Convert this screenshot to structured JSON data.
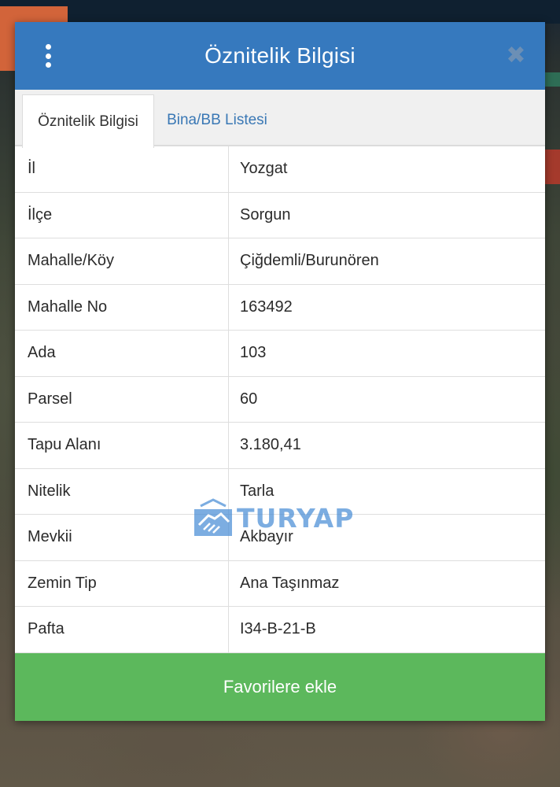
{
  "dialog": {
    "title": "Öznitelik Bilgisi",
    "tabs": [
      {
        "label": "Öznitelik Bilgisi",
        "active": true
      },
      {
        "label": "Bina/BB Listesi",
        "active": false
      }
    ],
    "rows": [
      {
        "label": "İl",
        "value": "Yozgat"
      },
      {
        "label": "İlçe",
        "value": "Sorgun"
      },
      {
        "label": "Mahalle/Köy",
        "value": "Çiğdemli/Burunören"
      },
      {
        "label": "Mahalle No",
        "value": "163492"
      },
      {
        "label": "Ada",
        "value": "103"
      },
      {
        "label": "Parsel",
        "value": "60"
      },
      {
        "label": "Tapu Alanı",
        "value": "3.180,41"
      },
      {
        "label": "Nitelik",
        "value": "Tarla"
      },
      {
        "label": "Mevkii",
        "value": "Akbayır"
      },
      {
        "label": "Zemin Tip",
        "value": "Ana Taşınmaz"
      },
      {
        "label": "Pafta",
        "value": "I34-B-21-B"
      }
    ],
    "favorite_button": "Favorilere ekle"
  },
  "watermark": {
    "text": "TURYAP"
  },
  "icons": {
    "menu": "more-vertical-icon",
    "close": "close-icon"
  },
  "colors": {
    "header": "#3679be",
    "favorite_button": "#5cb85c",
    "tab_link": "#3a78b5"
  }
}
